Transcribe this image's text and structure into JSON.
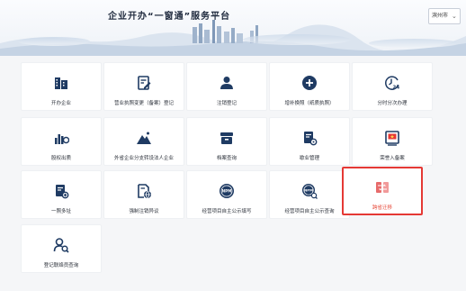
{
  "header": {
    "title": "企业开办“一窗通”服务平台",
    "city_select": "滨州市"
  },
  "colors": {
    "icon_primary": "#1f3b63",
    "highlight_border": "#e53935",
    "highlight_icon": "#e76b6b"
  },
  "services": [
    {
      "label": "开办企业",
      "icon": "building-icon"
    },
    {
      "label": "营业执照变更（备案）登记",
      "icon": "edit-document-icon"
    },
    {
      "label": "注销登记",
      "icon": "person-icon"
    },
    {
      "label": "增补换照（纸质执照）",
      "icon": "add-circle-icon"
    },
    {
      "label": "分时分次办理",
      "icon": "clock-24-icon"
    },
    {
      "label": "股权出质",
      "icon": "chart-bars-icon"
    },
    {
      "label": "外省企业分支转设法人企业",
      "icon": "mountain-icon"
    },
    {
      "label": "档案查询",
      "icon": "archive-box-icon"
    },
    {
      "label": "歇业管理",
      "icon": "document-gear-icon"
    },
    {
      "label": "荣誉入备案",
      "icon": "honor-frame-icon"
    },
    {
      "label": "一照多址",
      "icon": "document-plus-icon"
    },
    {
      "label": "强制注销异议",
      "icon": "document-globe-icon"
    },
    {
      "label": "经营项目自主公示填写",
      "icon": "npm-badge-icon"
    },
    {
      "label": "经营项目自主公示查询",
      "icon": "npm-search-icon"
    },
    {
      "label": "跨省迁移",
      "icon": "transfer-icon"
    },
    {
      "label": "登记联络员查询",
      "icon": "person-search-icon"
    }
  ]
}
